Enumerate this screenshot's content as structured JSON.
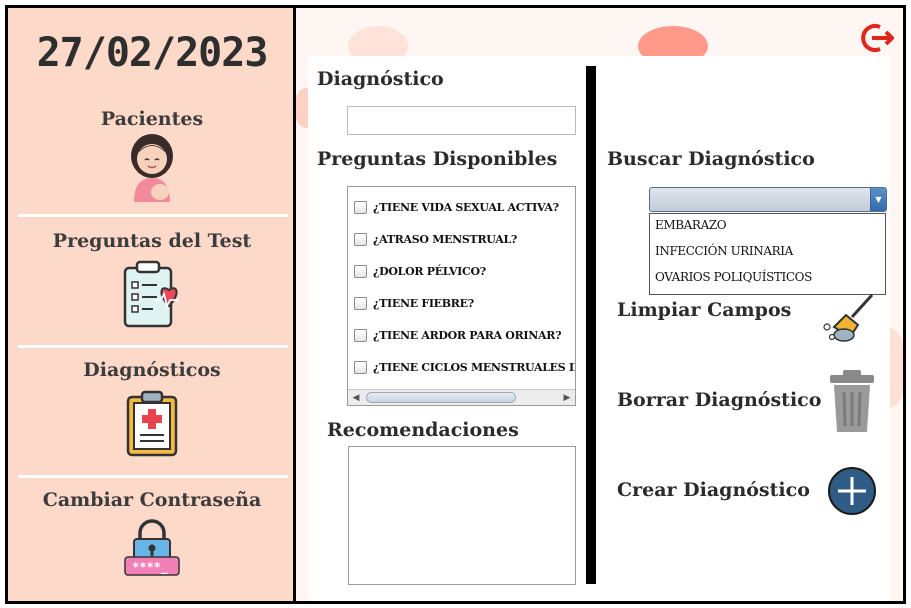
{
  "sidebar": {
    "date": "27/02/2023",
    "items": [
      {
        "label": "Pacientes",
        "icon": "patient-icon"
      },
      {
        "label": "Preguntas del Test",
        "icon": "clipboard-heartbeat-icon"
      },
      {
        "label": "Diagnósticos",
        "icon": "medical-clipboard-icon"
      },
      {
        "label": "Cambiar Contraseña",
        "icon": "password-lock-icon"
      }
    ]
  },
  "header": {
    "logout_icon": "logout-icon"
  },
  "form": {
    "diagnostico_label": "Diagnóstico",
    "diagnostico_value": "",
    "preguntas_label": "Preguntas Disponibles",
    "preguntas": [
      "¿TIENE VIDA SEXUAL ACTIVA?",
      "¿ATRASO MENSTRUAL?",
      "¿DOLOR PÉLVICO?",
      "¿TIENE FIEBRE?",
      "¿TIENE ARDOR PARA ORINAR?",
      "¿TIENE CICLOS MENSTRUALES IRRE"
    ],
    "recomendaciones_label": "Recomendaciones",
    "recomendaciones_value": ""
  },
  "search": {
    "label": "Buscar Diagnóstico",
    "selected": "",
    "options": [
      "EMBARAZO",
      "INFECCIÓN URINARIA",
      "OVARIOS POLIQUÍSTICOS"
    ]
  },
  "actions": {
    "limpiar": "Limpiar Campos",
    "borrar": "Borrar Diagnóstico",
    "crear": "Crear Diagnóstico"
  },
  "colors": {
    "sidebar_bg": "#fdd9c9",
    "accent_blue": "#2f6bb0",
    "logout_red": "#e0251b"
  }
}
